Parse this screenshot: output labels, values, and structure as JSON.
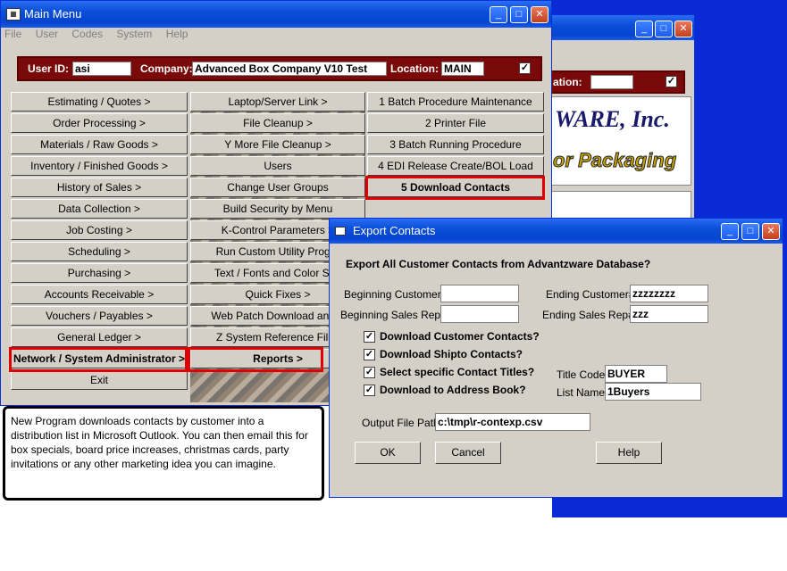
{
  "main_window": {
    "title": "Main Menu",
    "menu": [
      "File",
      "User",
      "Codes",
      "System",
      "Help"
    ],
    "user_id_label": "User ID:",
    "user_id": "asi",
    "company_label": "Company:",
    "company": "Advanced Box Company V10 Test",
    "location_label": "Location:",
    "location": "MAIN",
    "col1": [
      "Estimating / Quotes >",
      "Order Processing >",
      "Materials / Raw Goods >",
      "Inventory / Finished Goods >",
      "History of Sales >",
      "Data Collection >",
      "Job Costing >",
      "Scheduling >",
      "Purchasing >",
      "Accounts Receivable >",
      "Vouchers / Payables >",
      "General Ledger >",
      "Network / System Administrator >",
      "Exit"
    ],
    "col2": [
      "Laptop/Server Link >",
      "File Cleanup >",
      "Y More File Cleanup >",
      "Users",
      "Change User Groups",
      "Build Security by Menu",
      "K-Control Parameters >",
      "Run Custom Utility Progra",
      "Text / Fonts and Color Sett",
      "Quick Fixes >",
      "Web Patch Download and F",
      "Z System Reference Files",
      "Reports >"
    ],
    "col3": [
      "1 Batch Procedure Maintenance",
      "2 Printer File",
      "3 Batch Running Procedure",
      "4 EDI Release Create/BOL Load",
      "5 Download Contacts"
    ]
  },
  "back_window": {
    "location_label": "ation:",
    "logo_line1": "WARE, Inc.",
    "logo_line2": "or Packaging"
  },
  "note": "New Program downloads contacts by customer into a distribution list in Microsoft Outlook.   You can then email this for box specials, board price increases, christmas cards, party invitations or any other marketing idea you can imagine.",
  "dialog": {
    "title": "Export Contacts",
    "heading": "Export All Customer Contacts from Advantzware Database?",
    "begin_cust_label": "Beginning Customer#:",
    "begin_cust": "",
    "end_cust_label": "Ending Customer#:",
    "end_cust": "zzzzzzzz",
    "begin_rep_label": "Beginning Sales Rep#:",
    "begin_rep": "",
    "end_rep_label": "Ending Sales Rep#:",
    "end_rep": "zzz",
    "opt1": "Download Customer Contacts?",
    "opt2": "Download Shipto Contacts?",
    "opt3": "Select specific Contact Titles?",
    "opt4": "Download to Address Book?",
    "title_code_label": "Title Code:",
    "title_code": "BUYER",
    "list_name_label": "List Name:",
    "list_name": "1Buyers",
    "output_label": "Output File Path:",
    "output": "c:\\tmp\\r-contexp.csv",
    "ok": "OK",
    "cancel": "Cancel",
    "help": "Help"
  }
}
